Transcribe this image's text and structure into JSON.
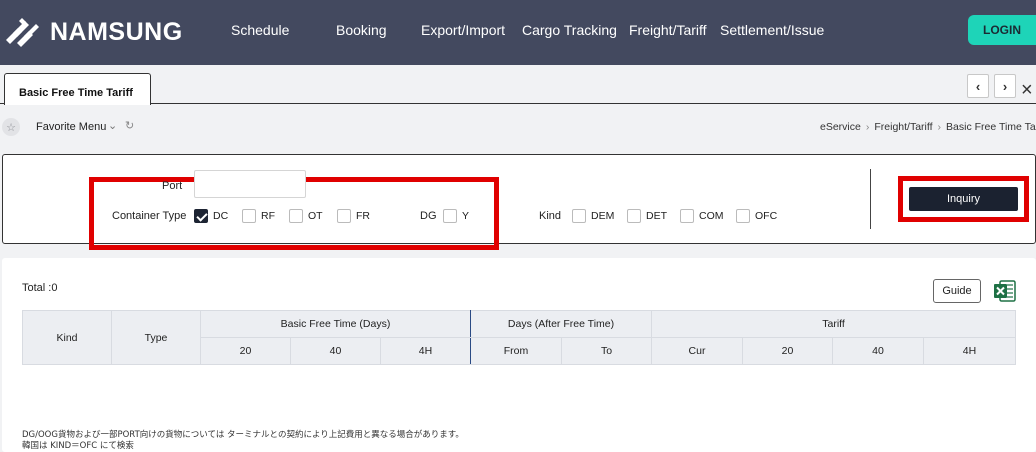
{
  "header": {
    "brand": "NAMSUNG",
    "nav": [
      "Schedule",
      "Booking",
      "Export/Import",
      "Cargo Tracking",
      "Freight/Tariff",
      "Settlement/Issue"
    ],
    "login": "LOGIN",
    "colors": {
      "header_bg": "#43495f",
      "login_bg": "#1ed4b8"
    }
  },
  "tabs": {
    "active": "Basic Free Time Tariff",
    "prev": "‹",
    "next": "›",
    "close": "×"
  },
  "favorite": {
    "label": "Favorite Menu"
  },
  "breadcrumb": [
    "eService",
    "Freight/Tariff",
    "Basic Free Time Tariff"
  ],
  "search": {
    "port_label": "Port",
    "port_value": "",
    "container_type_label": "Container Type",
    "container_types": [
      {
        "label": "DC",
        "checked": true
      },
      {
        "label": "RF",
        "checked": false
      },
      {
        "label": "OT",
        "checked": false
      },
      {
        "label": "FR",
        "checked": false
      }
    ],
    "dg_label": "DG",
    "dg_option": {
      "label": "Y",
      "checked": false
    },
    "kind_label": "Kind",
    "kinds": [
      {
        "label": "DEM",
        "checked": false
      },
      {
        "label": "DET",
        "checked": false
      },
      {
        "label": "COM",
        "checked": false
      },
      {
        "label": "OFC",
        "checked": false
      }
    ],
    "inquiry": "Inquiry"
  },
  "results": {
    "total": "Total :0",
    "guide": "Guide",
    "columns": {
      "kind": "Kind",
      "type": "Type",
      "basic_free_time": "Basic Free Time (Days)",
      "days_after": "Days (After Free Time)",
      "tariff": "Tariff",
      "bft_sub": [
        "20",
        "40",
        "4H"
      ],
      "days_sub": [
        "From",
        "To"
      ],
      "tariff_sub": [
        "Cur",
        "20",
        "40",
        "4H"
      ]
    }
  },
  "notes": [
    "DG/OOG貨物および一部PORT向けの貨物については ターミナルとの契約により上記費用と異なる場合があります。",
    "韓国は KIND＝OFC にて検索"
  ]
}
